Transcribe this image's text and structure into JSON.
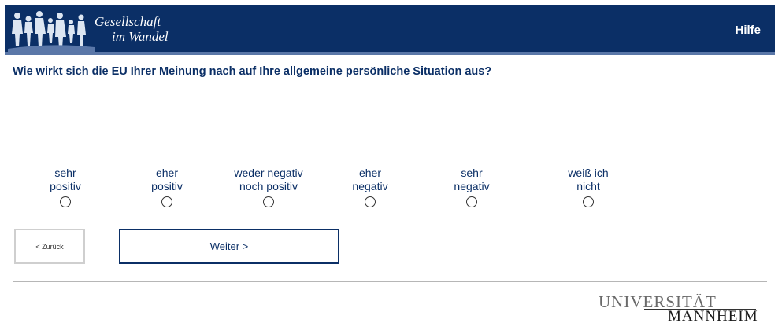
{
  "header": {
    "logo_line1": "Gesellschaft",
    "logo_line2": "im Wandel",
    "help_label": "Hilfe",
    "background_color": "#0b2f66"
  },
  "question": {
    "text": "Wie wirkt sich die EU Ihrer Meinung nach auf Ihre allgemeine persönliche Situation aus?"
  },
  "options": [
    {
      "label": "sehr\npositiv",
      "selected": false
    },
    {
      "label": "eher\npositiv",
      "selected": false
    },
    {
      "label": "weder negativ\nnoch positiv",
      "selected": false
    },
    {
      "label": "eher\nnegativ",
      "selected": false
    },
    {
      "label": "sehr\nnegativ",
      "selected": false
    },
    {
      "label": "weiß ich\nnicht",
      "selected": false
    }
  ],
  "navigation": {
    "back_label": "< Zurück",
    "next_label": "Weiter >"
  },
  "footer": {
    "university_line1": "UNIVERSITÄT",
    "university_line2": "MANNHEIM"
  },
  "colors": {
    "accent": "#0b2f66",
    "divider": "#b6b6b6"
  }
}
